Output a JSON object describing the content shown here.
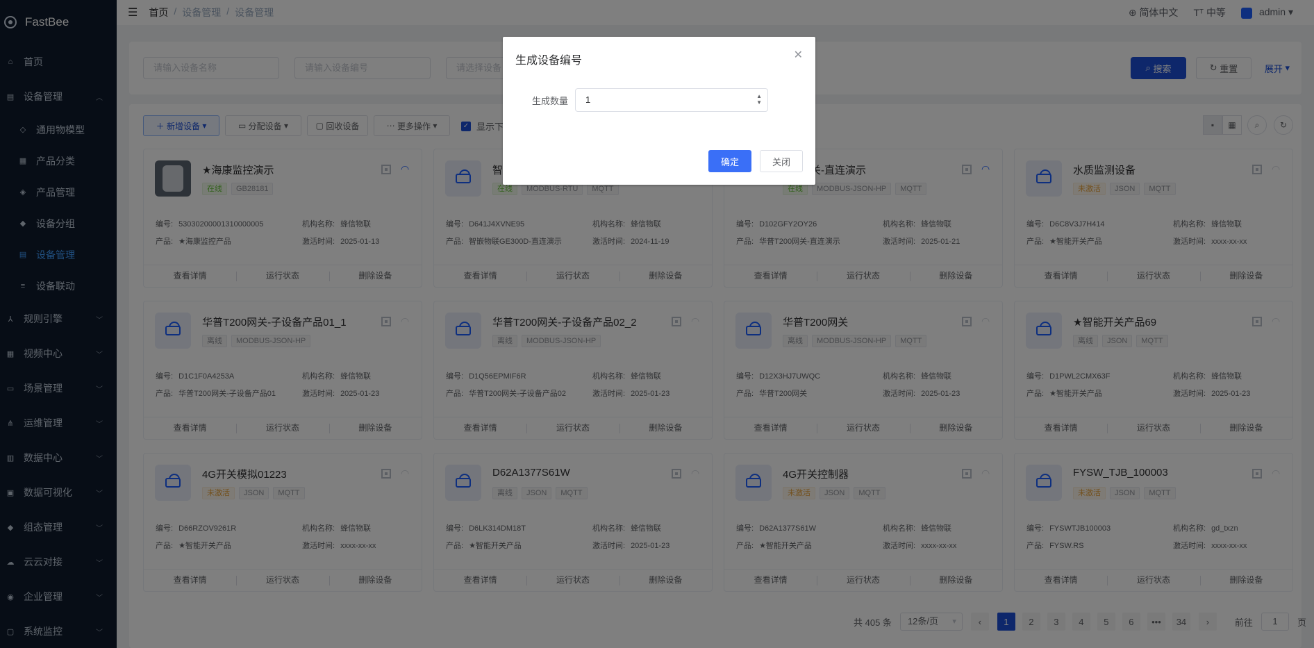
{
  "app": {
    "name": "FastBee"
  },
  "sidebar": {
    "items": [
      {
        "label": "首页",
        "icon": "home-icon"
      },
      {
        "label": "设备管理",
        "icon": "device-icon",
        "expanded": true,
        "children": [
          {
            "label": "通用物模型",
            "icon": "model-icon"
          },
          {
            "label": "产品分类",
            "icon": "category-icon"
          },
          {
            "label": "产品管理",
            "icon": "product-icon"
          },
          {
            "label": "设备分组",
            "icon": "group-icon"
          },
          {
            "label": "设备管理",
            "icon": "device-icon",
            "active": true
          },
          {
            "label": "设备联动",
            "icon": "link-icon"
          }
        ]
      },
      {
        "label": "规则引擎",
        "icon": "rule-icon"
      },
      {
        "label": "视频中心",
        "icon": "video-icon"
      },
      {
        "label": "场景管理",
        "icon": "scene-icon"
      },
      {
        "label": "运维管理",
        "icon": "ops-icon"
      },
      {
        "label": "数据中心",
        "icon": "data-icon"
      },
      {
        "label": "数据可视化",
        "icon": "chart-icon"
      },
      {
        "label": "组态管理",
        "icon": "config-icon"
      },
      {
        "label": "云云对接",
        "icon": "cloud-icon"
      },
      {
        "label": "企业管理",
        "icon": "enterprise-icon"
      },
      {
        "label": "系统监控",
        "icon": "monitor-icon"
      }
    ]
  },
  "header": {
    "breadcrumb": [
      "首页",
      "/",
      "设备管理",
      "/",
      "设备管理"
    ],
    "language": "简体中文",
    "size": "中等",
    "user": "admin"
  },
  "search": {
    "name_placeholder": "请输入设备名称",
    "serial_placeholder": "请输入设备编号",
    "status_placeholder": "请选择设备",
    "search_label": "搜索",
    "reset_label": "重置",
    "expand_label": "展开"
  },
  "toolbar": {
    "add_label": "新增设备",
    "assign_label": "分配设备",
    "recycle_label": "回收设备",
    "more_label": "更多操作",
    "show_sub_label": "显示下"
  },
  "card_labels": {
    "serial": "编号:",
    "org": "机构名称:",
    "product": "产品:",
    "activated": "激活时间:",
    "detail": "查看详情",
    "status": "运行状态",
    "delete": "删除设备"
  },
  "devices": [
    {
      "name": "★海康监控演示",
      "tags": [
        {
          "t": "在线",
          "k": "online"
        },
        {
          "t": "GB28181",
          "k": ""
        }
      ],
      "serial": "53030200001310000005",
      "org": "蜂信物联",
      "product": "★海康监控产品",
      "activated": "2025-01-13",
      "thumb": "camera",
      "wifi": "on"
    },
    {
      "name": "智",
      "tags": [
        {
          "t": "在线",
          "k": "online"
        },
        {
          "t": "MODBUS-RTU",
          "k": ""
        },
        {
          "t": "MQTT",
          "k": ""
        }
      ],
      "serial": "D641J4XVNE95",
      "org": "蜂信物联",
      "product": "智嵌物联GE300D-直连演示",
      "activated": "2024-11-19",
      "thumb": "router",
      "wifi": "none"
    },
    {
      "name": "200网关-直连演示",
      "tags": [
        {
          "t": "在线",
          "k": "online"
        },
        {
          "t": "MODBUS-JSON-HP",
          "k": ""
        },
        {
          "t": "MQTT",
          "k": ""
        }
      ],
      "serial": "D102GFY2OY26",
      "org": "蜂信物联",
      "product": "华普T200网关-直连演示",
      "activated": "2025-01-21",
      "thumb": "none",
      "wifi": "on"
    },
    {
      "name": "水质监测设备",
      "tags": [
        {
          "t": "未激活",
          "k": "inactive"
        },
        {
          "t": "JSON",
          "k": ""
        },
        {
          "t": "MQTT",
          "k": ""
        }
      ],
      "serial": "D6C8V3J7H414",
      "org": "蜂信物联",
      "product": "★智能开关产品",
      "activated": "xxxx-xx-xx",
      "thumb": "router",
      "wifi": "off"
    },
    {
      "name": "华普T200网关-子设备产品01_1",
      "tags": [
        {
          "t": "离线",
          "k": ""
        },
        {
          "t": "MODBUS-JSON-HP",
          "k": ""
        }
      ],
      "serial": "D1C1F0A4253A",
      "org": "蜂信物联",
      "product": "华普T200网关-子设备产品01",
      "activated": "2025-01-23",
      "thumb": "router",
      "wifi": "off"
    },
    {
      "name": "华普T200网关-子设备产品02_2",
      "tags": [
        {
          "t": "离线",
          "k": ""
        },
        {
          "t": "MODBUS-JSON-HP",
          "k": ""
        }
      ],
      "serial": "D1Q56EPMIF6R",
      "org": "蜂信物联",
      "product": "华普T200网关-子设备产品02",
      "activated": "2025-01-23",
      "thumb": "router",
      "wifi": "off"
    },
    {
      "name": "华普T200网关",
      "tags": [
        {
          "t": "离线",
          "k": ""
        },
        {
          "t": "MODBUS-JSON-HP",
          "k": ""
        },
        {
          "t": "MQTT",
          "k": ""
        }
      ],
      "serial": "D12X3HJ7UWQC",
      "org": "蜂信物联",
      "product": "华普T200网关",
      "activated": "2025-01-23",
      "thumb": "router",
      "wifi": "off"
    },
    {
      "name": "★智能开关产品69",
      "tags": [
        {
          "t": "离线",
          "k": ""
        },
        {
          "t": "JSON",
          "k": ""
        },
        {
          "t": "MQTT",
          "k": ""
        }
      ],
      "serial": "D1PWL2CMX63F",
      "org": "蜂信物联",
      "product": "★智能开关产品",
      "activated": "2025-01-23",
      "thumb": "router",
      "wifi": "off"
    },
    {
      "name": "4G开关模拟01223",
      "tags": [
        {
          "t": "未激活",
          "k": "inactive"
        },
        {
          "t": "JSON",
          "k": ""
        },
        {
          "t": "MQTT",
          "k": ""
        }
      ],
      "serial": "D66RZOV9261R",
      "org": "蜂信物联",
      "product": "★智能开关产品",
      "activated": "xxxx-xx-xx",
      "thumb": "router",
      "wifi": "off"
    },
    {
      "name": "D62A1377S61W",
      "tags": [
        {
          "t": "离线",
          "k": ""
        },
        {
          "t": "JSON",
          "k": ""
        },
        {
          "t": "MQTT",
          "k": ""
        }
      ],
      "serial": "D6LK314DM18T",
      "org": "蜂信物联",
      "product": "★智能开关产品",
      "activated": "2025-01-23",
      "thumb": "router",
      "wifi": "off"
    },
    {
      "name": "4G开关控制器",
      "tags": [
        {
          "t": "未激活",
          "k": "inactive"
        },
        {
          "t": "JSON",
          "k": ""
        },
        {
          "t": "MQTT",
          "k": ""
        }
      ],
      "serial": "D62A1377S61W",
      "org": "蜂信物联",
      "product": "★智能开关产品",
      "activated": "xxxx-xx-xx",
      "thumb": "router",
      "wifi": "off"
    },
    {
      "name": "FYSW_TJB_100003",
      "tags": [
        {
          "t": "未激活",
          "k": "inactive"
        },
        {
          "t": "JSON",
          "k": ""
        },
        {
          "t": "MQTT",
          "k": ""
        }
      ],
      "serial": "FYSWTJB100003",
      "org": "gd_txzn",
      "product": "FYSW.RS",
      "activated": "xxxx-xx-xx",
      "thumb": "router",
      "wifi": "off"
    }
  ],
  "pagination": {
    "total": "共 405 条",
    "page_size": "12条/页",
    "pages": [
      "1",
      "2",
      "3",
      "4",
      "5",
      "6",
      "•••",
      "34"
    ],
    "current": "1",
    "goto_label": "前往",
    "goto_value": "1",
    "page_suffix": "页"
  },
  "dialog": {
    "title": "生成设备编号",
    "count_label": "生成数量",
    "count_value": "1",
    "confirm_label": "确定",
    "cancel_label": "关闭"
  },
  "colors": {
    "primary": "#1d4fd6",
    "sidebar_bg": "#0f1a2c",
    "active_menu": "#409eff",
    "online": "#67c23a",
    "inactive": "#e6a23c"
  }
}
